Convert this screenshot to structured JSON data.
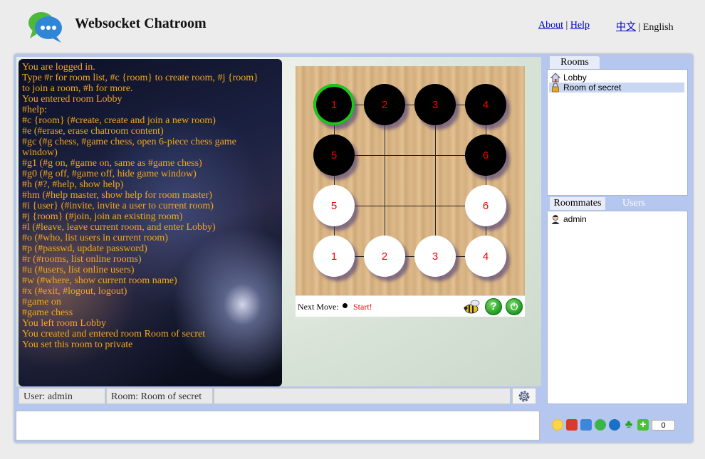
{
  "header": {
    "title": "Websocket Chatroom",
    "links": {
      "about": "About",
      "separator": "|",
      "help": "Help"
    },
    "lang": {
      "chinese": "中文",
      "separator": "|",
      "english": "English"
    }
  },
  "chat_log": [
    "You are logged in.",
    "Type #r for room list, #c {room} to create room, #j {room}",
    "to join a room, #h for more.",
    "You entered room Lobby",
    "#help:",
    "#c {room} (#create, create and join a new room)",
    "#e (#erase, erase chatroom content)",
    "#gc (#g chess, #game chess, open 6-piece chess game",
    "window)",
    "#g1 (#g on, #game on, same as #game chess)",
    "#g0 (#g off, #game off, hide game window)",
    "#h (#?, #help, show help)",
    "#hm (#help master, show help for room master)",
    "#i {user} (#invite, invite a user to current room)",
    "#j {room} (#join, join an existing room)",
    "#l (#leave, leave current room, and enter Lobby)",
    "#o (#who, list users in current room)",
    "#p (#passwd, update password)",
    "#r (#rooms, list online rooms)",
    "#u (#users, list online users)",
    "#w (#where, show current room name)",
    "#x (#exit, #logout, logout)",
    "#game on",
    "#game chess",
    "You left room Lobby",
    "You created and entered room Room of secret",
    "You set this room to private"
  ],
  "board": {
    "stones": [
      {
        "label": "1",
        "color": "black",
        "row": 0,
        "col": 0,
        "selected": true
      },
      {
        "label": "2",
        "color": "black",
        "row": 0,
        "col": 1
      },
      {
        "label": "3",
        "color": "black",
        "row": 0,
        "col": 2
      },
      {
        "label": "4",
        "color": "black",
        "row": 0,
        "col": 3
      },
      {
        "label": "5",
        "color": "black",
        "row": 1,
        "col": 0
      },
      {
        "label": "6",
        "color": "black",
        "row": 1,
        "col": 3
      },
      {
        "label": "5",
        "color": "white",
        "row": 2,
        "col": 0
      },
      {
        "label": "6",
        "color": "white",
        "row": 2,
        "col": 3
      },
      {
        "label": "1",
        "color": "white",
        "row": 3,
        "col": 0
      },
      {
        "label": "2",
        "color": "white",
        "row": 3,
        "col": 1
      },
      {
        "label": "3",
        "color": "white",
        "row": 3,
        "col": 2
      },
      {
        "label": "4",
        "color": "white",
        "row": 3,
        "col": 3
      }
    ],
    "next_move_label": "Next Move:",
    "start_label": "Start!",
    "help_symbol": "?",
    "power_symbol": "⏻"
  },
  "status_bar": {
    "user": "User: admin",
    "room": "Room: Room of secret"
  },
  "rooms_panel": {
    "tab_label": "Rooms",
    "items": [
      {
        "label": "Lobby",
        "icon": "house-icon"
      },
      {
        "label": "Room of secret",
        "icon": "lock-icon",
        "selected": true
      }
    ]
  },
  "users_panel": {
    "roommates_tab": "Roommates",
    "users_tab": "Users",
    "items": [
      {
        "label": "admin",
        "icon": "user-icon"
      }
    ]
  },
  "emoji_bar": {
    "count": "0"
  },
  "colors": {
    "chat_text": "#f7a71a",
    "frame": "#b5c7ee",
    "stone_number": "#ee0000"
  }
}
